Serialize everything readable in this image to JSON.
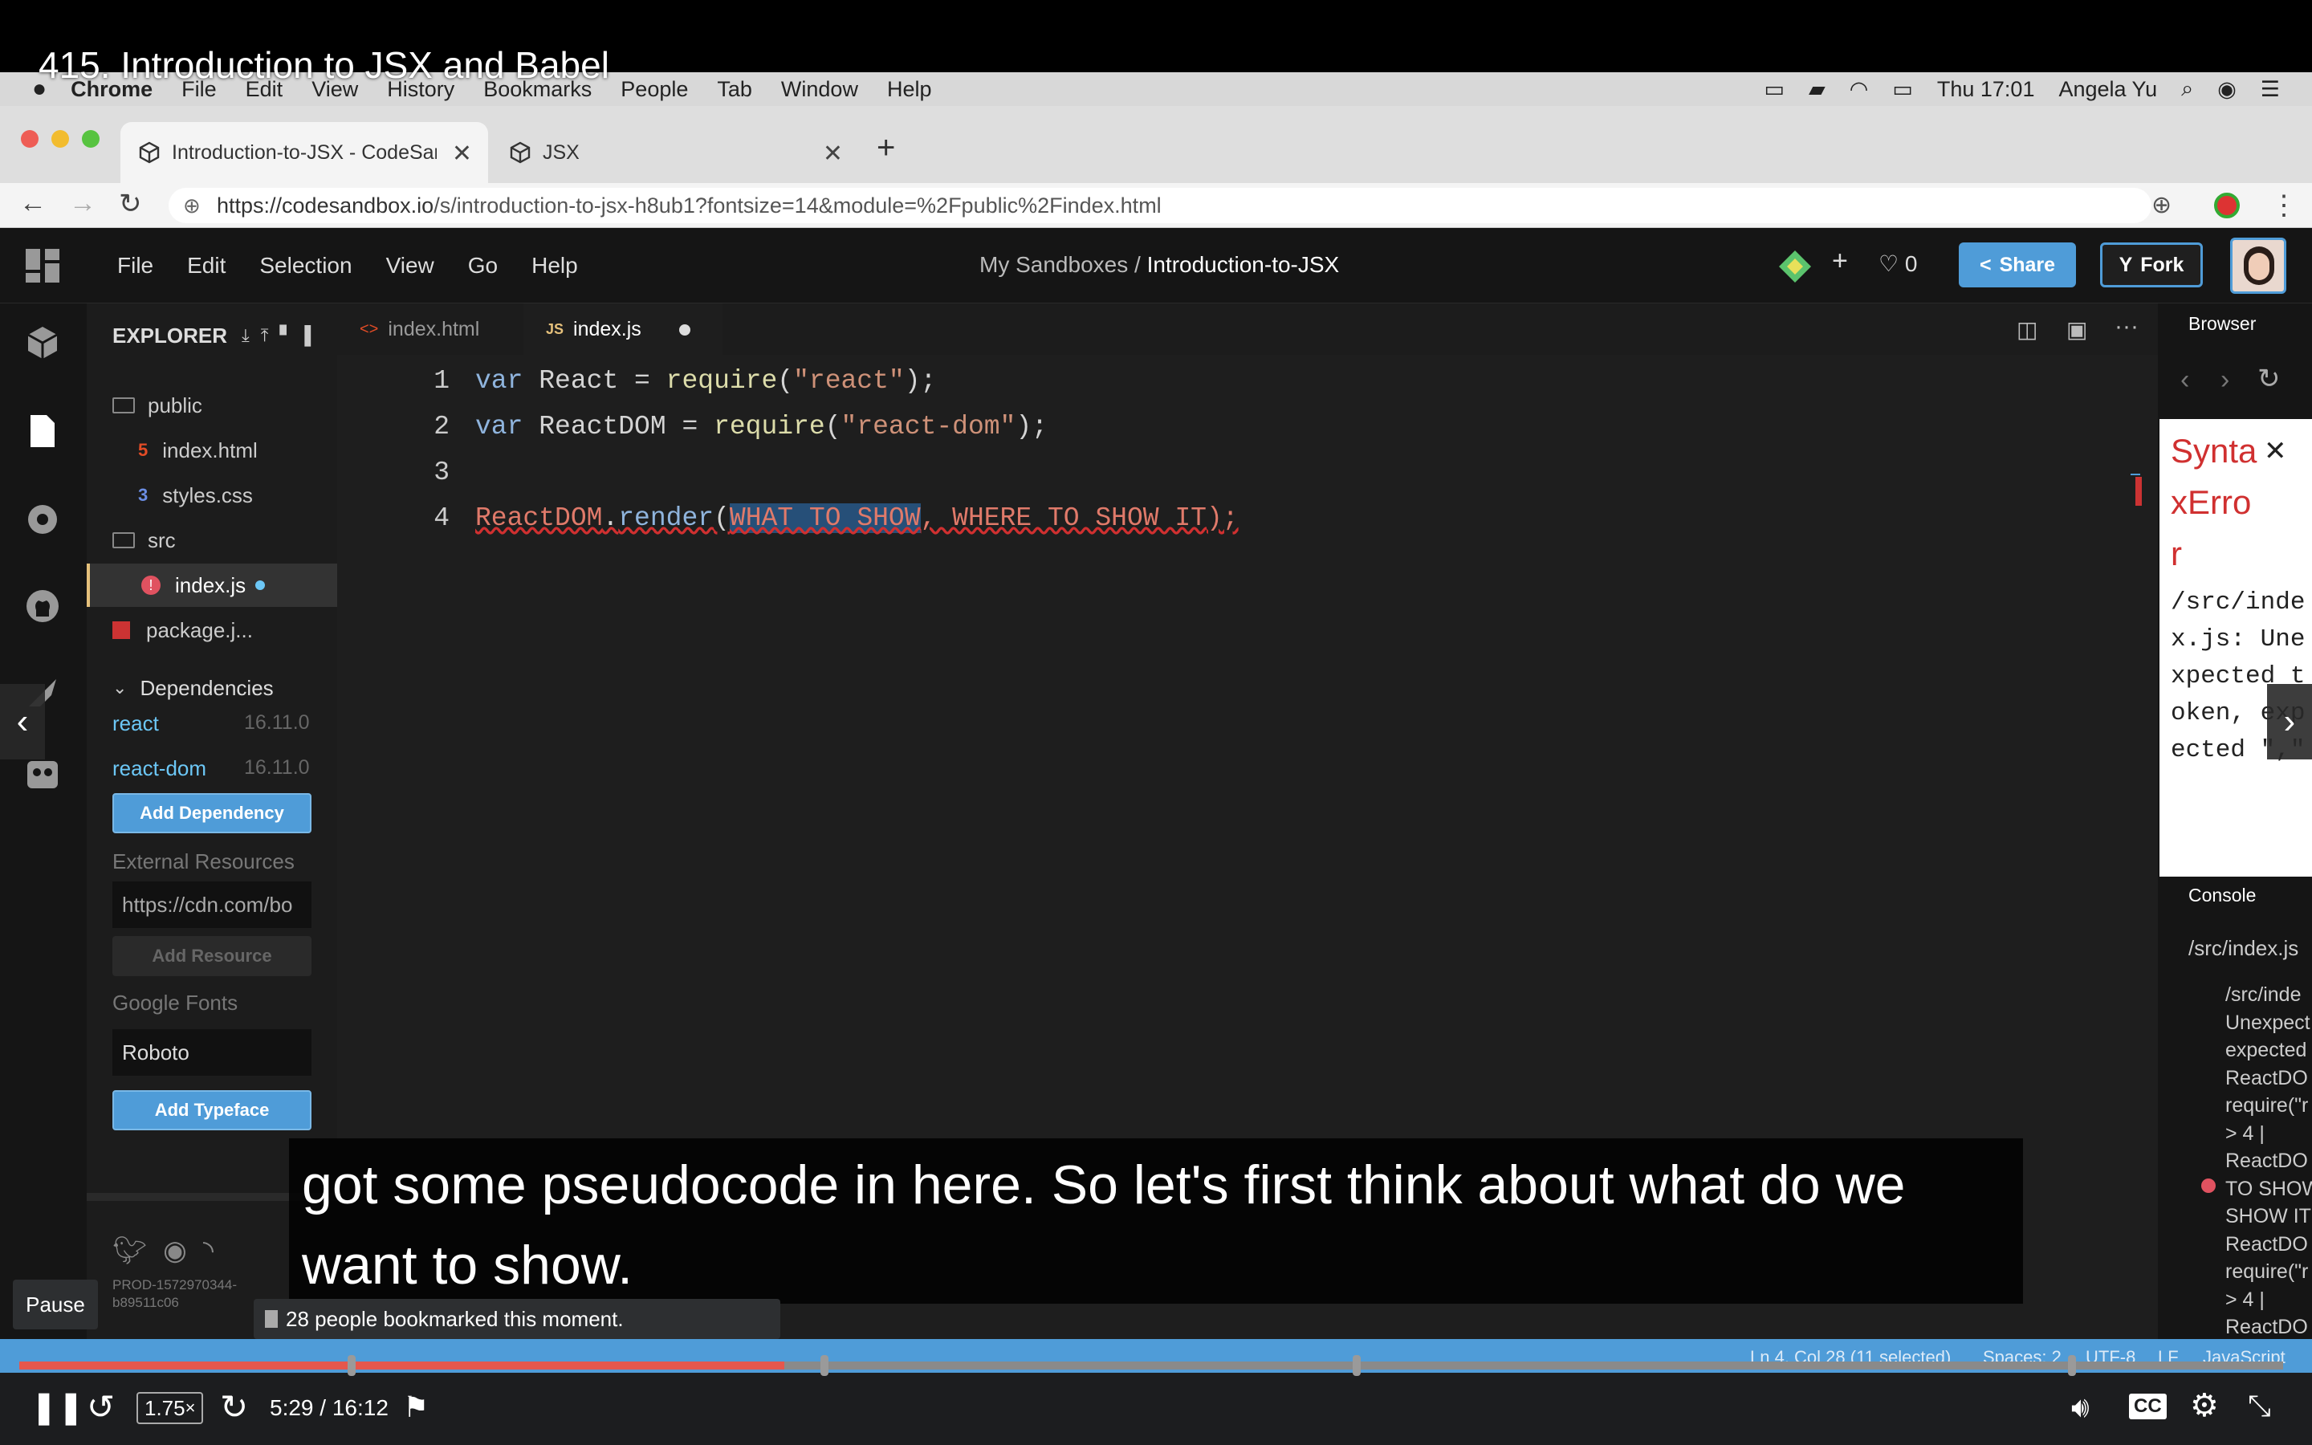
{
  "video": {
    "title": "415. Introduction to JSX and Babel"
  },
  "mac_menubar": {
    "app": "Chrome",
    "items": [
      "File",
      "Edit",
      "View",
      "History",
      "Bookmarks",
      "People",
      "Tab",
      "Window",
      "Help"
    ],
    "clock": "Thu 17:01",
    "user": "Angela Yu"
  },
  "chrome": {
    "tabs": [
      {
        "title": "Introduction-to-JSX - CodeSand",
        "icon": "cube-icon",
        "active": true
      },
      {
        "title": "JSX",
        "icon": "cube-icon",
        "active": false
      }
    ],
    "new_tab": "+",
    "url_host": "https://codesandbox.io",
    "url_path": "/s/introduction-to-jsx-h8ub1?fontsize=14&module=%2Fpublic%2Findex.html"
  },
  "csb": {
    "menu": [
      "File",
      "Edit",
      "Selection",
      "View",
      "Go",
      "Help"
    ],
    "path_prefix": "My Sandboxes /",
    "sandbox_name": "Introduction-to-JSX",
    "plus": "+",
    "likes": "0",
    "share": "Share",
    "fork": "Fork"
  },
  "explorer": {
    "title": "EXPLORER",
    "files": [
      {
        "name": "public",
        "type": "folder",
        "indent": 0
      },
      {
        "name": "index.html",
        "type": "html",
        "indent": 1
      },
      {
        "name": "styles.css",
        "type": "css",
        "indent": 1
      },
      {
        "name": "src",
        "type": "folder",
        "indent": 0
      },
      {
        "name": "index.js",
        "type": "js-error",
        "indent": 1
      },
      {
        "name": "package.j...",
        "type": "json",
        "indent": 0
      }
    ],
    "dependencies_title": "Dependencies",
    "dependencies": [
      {
        "name": "react",
        "version": "16.11.0"
      },
      {
        "name": "react-dom",
        "version": "16.11.0"
      }
    ],
    "add_dependency": "Add Dependency",
    "external_resources": "External Resources",
    "external_placeholder": "https://cdn.com/bo",
    "add_resource": "Add Resource",
    "google_fonts": "Google Fonts",
    "font_value": "Roboto",
    "add_typeface": "Add Typeface",
    "build_id_1": "PROD-1572970344-",
    "build_id_2": "b89511c06"
  },
  "editor": {
    "tabs": [
      {
        "label": "index.html",
        "icon": "<>"
      },
      {
        "label": "index.js",
        "icon": "JS"
      }
    ],
    "lines": [
      {
        "n": "1"
      },
      {
        "n": "2"
      },
      {
        "n": "3"
      },
      {
        "n": "4"
      }
    ],
    "code": {
      "l1_var": "var",
      "l1_name": " React ",
      "l1_eq": "= ",
      "l1_fn": "require",
      "l1_open": "(",
      "l1_str": "\"react\"",
      "l1_close": ");",
      "l2_var": "var",
      "l2_name": " ReactDOM ",
      "l2_eq": "= ",
      "l2_fn": "require",
      "l2_open": "(",
      "l2_str": "\"react-dom\"",
      "l2_close": ");",
      "l4_obj": "ReactDOM",
      "l4_dot": ".",
      "l4_fn": "render",
      "l4_open": "(",
      "l4_sel": "WHAT TO SHOW",
      "l4_rest": ", WHERE TO SHOW IT",
      "l4_close": ");"
    }
  },
  "preview": {
    "browser_label": "Browser",
    "error_title": "SyntaxError",
    "error_message": "/src/index.js: Unexpected token, expected \",\"",
    "console_label": "Console",
    "console_file": "/src/index.js",
    "console_lines": [
      "/src/inde",
      "Unexpect",
      "expected",
      "ReactDO",
      "require(\"r",
      "> 4 |",
      "ReactDO",
      "TO SHOW",
      "SHOW IT",
      "ReactDO",
      "require(\"r",
      "> 4 |",
      "ReactDO"
    ]
  },
  "statusbar": {
    "position": "Ln 4, Col 28 (11 selected)",
    "spaces": "Spaces: 2",
    "encoding": "UTF-8",
    "eol": "LF",
    "language": "JavaScript"
  },
  "captions": {
    "line1": "got some pseudocode in here. So let's first think about what do we",
    "line2": "want to show."
  },
  "player": {
    "pause_tooltip": "Pause",
    "bookmark_tooltip": "28 people bookmarked this moment.",
    "speed": "1.75",
    "speed_suffix": "×",
    "time": "5:29 / 16:12",
    "progress": 0.338,
    "bookmarks_at": [
      0.145,
      0.354,
      0.589,
      0.905
    ]
  },
  "colors": {
    "accent": "#4f9cd8",
    "error": "#e07a6a",
    "progress": "#e5574d"
  }
}
